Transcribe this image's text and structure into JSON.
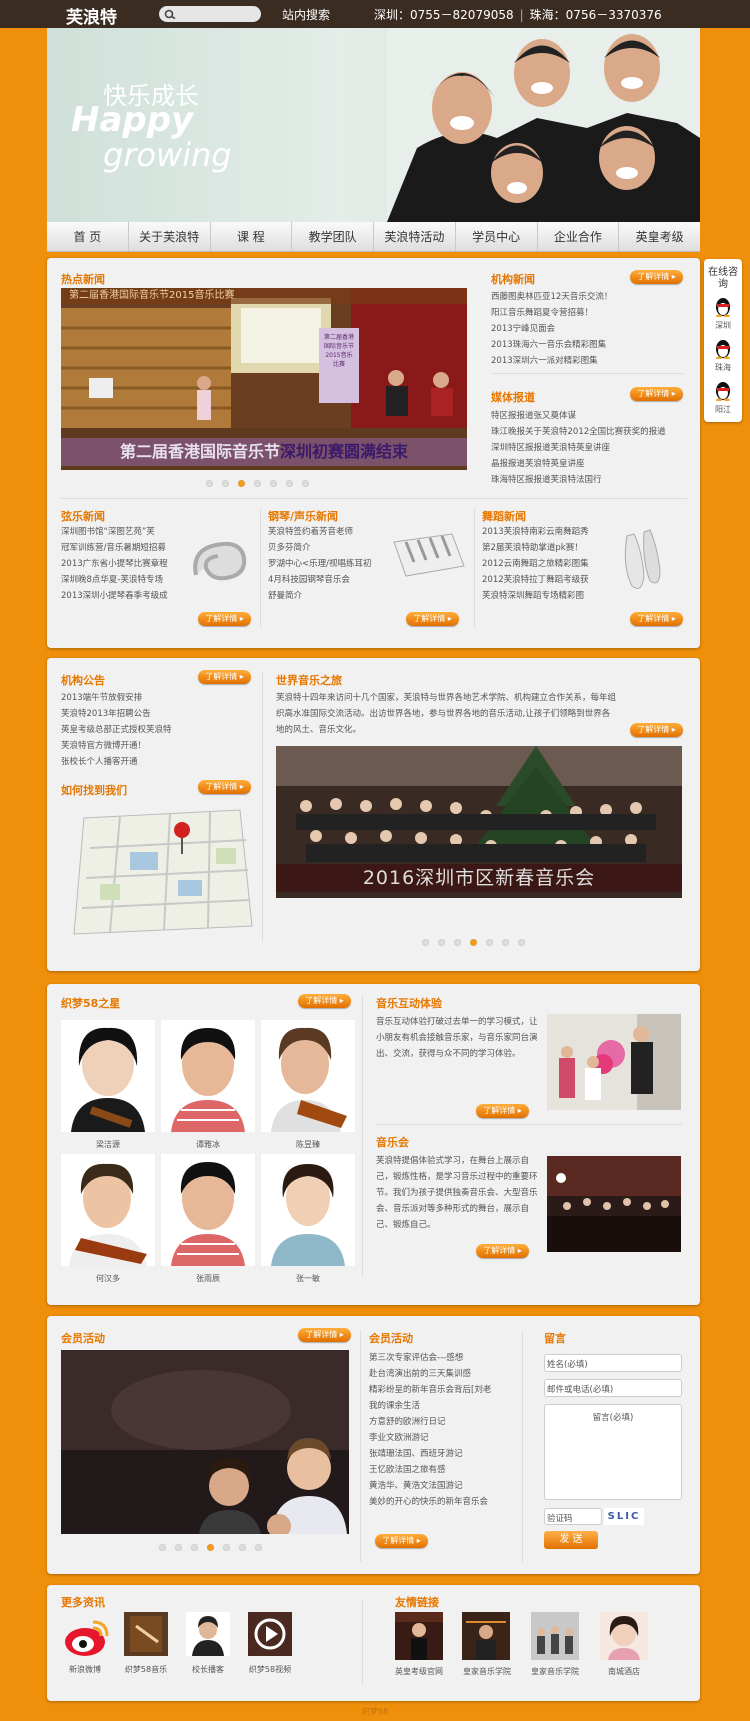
{
  "header": {
    "logo": "芙浪特",
    "search_placeholder": "",
    "site_search": "站内搜索",
    "phone_sz": "深圳：0755－82079058",
    "phone_zh": "珠海：0756－3370376"
  },
  "banner": {
    "cn": "快乐成长",
    "en1": "Happy",
    "en2": "growing"
  },
  "nav": [
    "首 页",
    "关于芙浪特",
    "课 程",
    "教学团队",
    "芙浪特活动",
    "学员中心",
    "企业合作",
    "英皇考级"
  ],
  "more": "了解详情 ▸",
  "hot_news": {
    "title": "热点新闻",
    "slide_caption_a": "第二届香港国际音乐节",
    "slide_caption_b": "深圳初赛圆满结束",
    "poster": "第二届香港国际音乐节2015音乐比赛",
    "slide_top": "第二届香港国际音乐节2015音乐比赛",
    "dots": 7,
    "active": 2
  },
  "org_news": {
    "title": "机构新闻",
    "items": [
      "西藤图奥林匹亚12天音乐交流！",
      "阳江音乐舞蹈夏令营招募！",
      "2013宁峰见面会",
      "2013珠海六一音乐会精彩图集",
      "2013深圳六一派对精彩图集"
    ]
  },
  "media": {
    "title": "媒体报道",
    "items": [
      "特区报报道张又奠体谋",
      "珠江晚报关于芙浪特2012全国比赛获奖的报道",
      "深圳特区报报道芙浪特英皇讲座",
      "晶报报道芙浪特英皇讲座",
      "珠海特区报报道芙浪特法国行"
    ]
  },
  "string_news": {
    "title": "弦乐新闻",
    "items": [
      "深圳图书馆“深图艺苑”芙",
      "冠军训练营/音乐暑期短招募",
      "2013广东省小提琴比赛章程",
      "深圳晚8点华夏-芙浪特专场",
      "2013深圳小提琴春季考级成"
    ]
  },
  "piano_news": {
    "title": "钢琴/声乐新闻",
    "items": [
      "芙浪特签约着芳音老师",
      "贝多芬简介",
      "罗湖中心<乐理/视唱练耳初",
      "4月科技园钢琴音乐会",
      "舒曼简介"
    ]
  },
  "dance_news": {
    "title": "舞蹈新闻",
    "items": [
      "2013芙浪特南彩云南舞蹈秀",
      "第2届芙浪特助掌道pk赛！",
      "2012云南舞蹈之旅精彩图集",
      "2012芙浪特拉丁舞蹈考级获",
      "芙浪特深圳舞蹈专场精彩图"
    ]
  },
  "notice": {
    "title": "机构公告",
    "items": [
      "2013端午节放假安排",
      "芙浪特2013年招聘公告",
      "英皇考级总部正式授权芙浪特",
      "芙浪特官方微博开通！",
      "张校长个人播客开通"
    ]
  },
  "find_us": {
    "title": "如何找到我们"
  },
  "world": {
    "title": "世界音乐之旅",
    "text": "芙浪特十四年来访问十几个国家，芙浪特与世界各地艺术学院、机构建立合作关系，每年组织高水准国际交流活动。出访世界各地，参与世界各地的音乐活动,让孩子们领略到世界各地的风土、音乐文化。",
    "slide_caption": "2016深圳市区新春音乐会",
    "dots": 7,
    "active": 3
  },
  "stars": {
    "title": "织梦58之星",
    "people": [
      "梁洁源",
      "谭雅冰",
      "陈昱臻",
      "何汉多",
      "张雨辰",
      "张一敏"
    ]
  },
  "interactive": {
    "title": "音乐互动体验",
    "text": "音乐互动体验打破过去单一的学习模式，让小朋友有机会接触音乐家，与音乐家同台演出、交流，获得与众不同的学习体验。"
  },
  "concert": {
    "title": "音乐会",
    "text": "芙浪特提倡体验式学习，在舞台上展示自己，锻炼性格，是学习音乐过程中的重要环节。我们为孩子提供独奏音乐会、大型音乐会、音乐派对等多种形式的舞台，展示自己、锻炼自己。"
  },
  "member_left": {
    "title": "会员活动",
    "dots": 7,
    "active": 3
  },
  "member_list": {
    "title": "会员活动",
    "items": [
      "第三次专家评估会---感想",
      "赴台湾演出前的三天集训感",
      "精彩纷呈的新年音乐会背后[刘老",
      "我的课余生活",
      "方意舒的欧洲行日记",
      "李业文欧洲游记",
      "张靖珊法国、西班牙游记",
      "王忆欧法国之旅有感",
      "黄浩华、黄浩文法国游记",
      "美妙的开心的快乐的新年音乐会"
    ]
  },
  "message": {
    "title": "留言",
    "name_ph": "姓名(必填)",
    "contact_ph": "邮件或电话(必填)",
    "msg_ph": "留言(必填)",
    "captcha_ph": "验证码",
    "captcha_img": "SLIC",
    "submit": "发 送"
  },
  "more_info": {
    "title": "更多资讯",
    "items": [
      "新浪微博",
      "织梦58音乐",
      "校长播客",
      "织梦58视频"
    ]
  },
  "links": {
    "title": "友情链接",
    "items": [
      "英皇考级官网",
      "皇家音乐学院",
      "皇家音乐学院",
      "南城酒店"
    ]
  },
  "footer": "织梦58",
  "online": {
    "title": "在线咨询",
    "items": [
      "深圳",
      "珠海",
      "阳江"
    ]
  }
}
